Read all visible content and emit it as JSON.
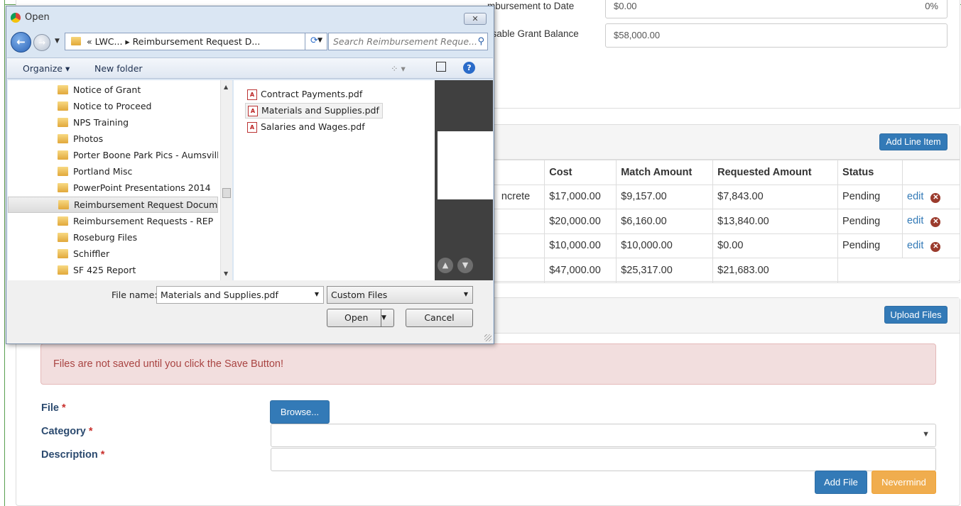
{
  "page": {
    "top_fields": [
      {
        "label": "mbursement to Date",
        "value": "$0.00",
        "right_value": "0%"
      },
      {
        "label": "rsable Grant Balance",
        "value": "$58,000.00"
      }
    ],
    "line_items": {
      "add_button": "Add Line Item",
      "columns": [
        "Cost",
        "Match Amount",
        "Requested Amount",
        "Status"
      ],
      "rows": [
        {
          "desc": "ncrete",
          "cost": "$17,000.00",
          "match": "$9,157.00",
          "requested": "$7,843.00",
          "status": "Pending",
          "edit": "edit"
        },
        {
          "desc": "",
          "cost": "$20,000.00",
          "match": "$6,160.00",
          "requested": "$13,840.00",
          "status": "Pending",
          "edit": "edit"
        },
        {
          "desc": "",
          "cost": "$10,000.00",
          "match": "$10,000.00",
          "requested": "$0.00",
          "status": "Pending",
          "edit": "edit"
        }
      ],
      "totals": {
        "cost": "$47,000.00",
        "match": "$25,317.00",
        "requested": "$21,683.00"
      }
    },
    "files": {
      "upload_button": "Upload Files",
      "alert": "Files are not saved until you click the Save Button!",
      "file_label": "File",
      "browse_button": "Browse...",
      "category_label": "Category",
      "description_label": "Description",
      "required_marker": "*",
      "add_file_button": "Add File",
      "nevermind_button": "Nevermind"
    }
  },
  "dialog": {
    "title": "Open",
    "close_glyph": "✕",
    "address_path": "« LWC... ▸ Reimbursement Request D...",
    "search_placeholder": "Search Reimbursement Reque...",
    "organize": "Organize ▾",
    "new_folder": "New folder",
    "folders": [
      "Notice of Grant",
      "Notice to Proceed",
      "NPS Training",
      "Photos",
      "Porter Boone Park Pics - Aumsville",
      "Portland Misc",
      "PowerPoint Presentations 2014",
      "Reimbursement Request Documents",
      "Reimbursement Requests - REP",
      "Roseburg Files",
      "Schiffler",
      "SF 425 Report"
    ],
    "selected_folder_index": 7,
    "files": [
      "Contract Payments.pdf",
      "Materials and Supplies.pdf",
      "Salaries and Wages.pdf"
    ],
    "selected_file_index": 1,
    "file_name_label": "File name:",
    "file_name_value": "Materials and Supplies.pdf",
    "file_type_value": "Custom Files",
    "open_button": "Open",
    "cancel_button": "Cancel"
  },
  "colors": {
    "primary": "#337ab7",
    "warning": "#f0ad4e",
    "alert_bg": "#f2dede",
    "alert_text": "#a94442"
  }
}
